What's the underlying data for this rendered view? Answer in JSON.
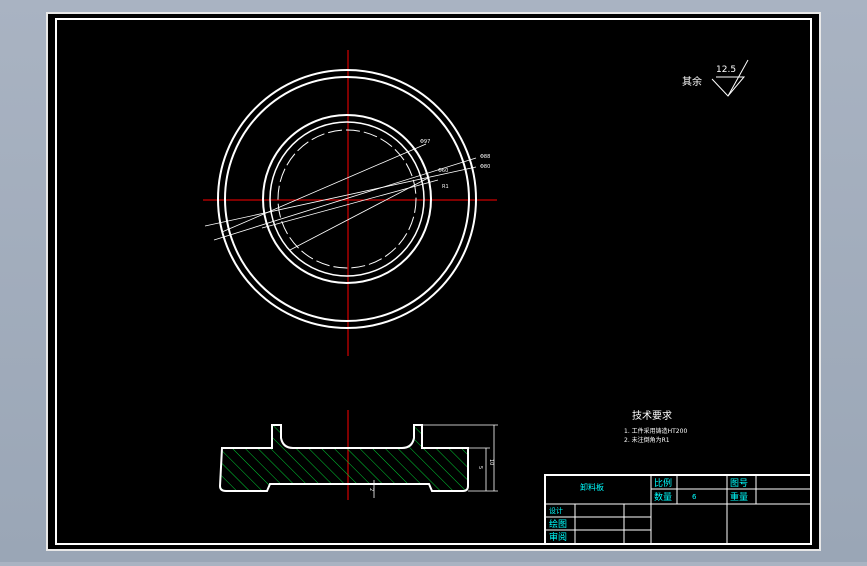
{
  "drawing": {
    "roughness": {
      "label": "其余",
      "value": "12.5"
    },
    "tech_requirements": {
      "title": "技术要求",
      "lines": [
        "1. 工件采用铸造HT200",
        "2. 未注倒角为R1"
      ]
    },
    "dimension_labels": {
      "d1": "Φ88",
      "d2": "Φ80",
      "d3": "Φ97",
      "d4": "Φ60",
      "d5": "R1",
      "height": "10",
      "height2": "5",
      "thickness": "2"
    },
    "title_block": {
      "part_name": "卸料板",
      "scale_label": "比例",
      "drawing_no_label": "图号",
      "quantity_label": "数量",
      "quantity_value": "6",
      "weight_label": "重量",
      "design_label": "设计",
      "draw_label": "绘图",
      "review_label": "审阅"
    },
    "colors": {
      "background": "#000000",
      "frame": "#ffffff",
      "center_line": "#ff0000",
      "hatch": "#00cc33",
      "title_text": "#00ffff"
    }
  }
}
